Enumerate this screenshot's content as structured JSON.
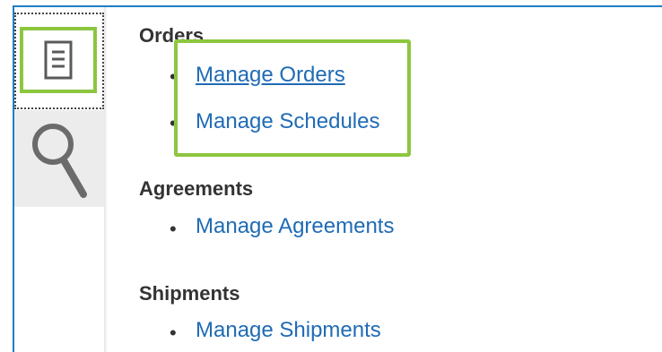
{
  "tabs": [
    {
      "name": "tasks",
      "icon": "document-list-icon",
      "active": true
    },
    {
      "name": "search",
      "icon": "search-icon",
      "active": false
    }
  ],
  "sections": {
    "orders": {
      "title": "Orders",
      "links": [
        "Manage Orders",
        "Manage Schedules"
      ]
    },
    "agreements": {
      "title": "Agreements",
      "links": [
        "Manage Agreements"
      ]
    },
    "shipments": {
      "title": "Shipments",
      "links": [
        "Manage Shipments"
      ]
    }
  },
  "colors": {
    "highlight": "#8dc63f",
    "link": "#1f6bb5",
    "frame": "#1e7fc2"
  }
}
